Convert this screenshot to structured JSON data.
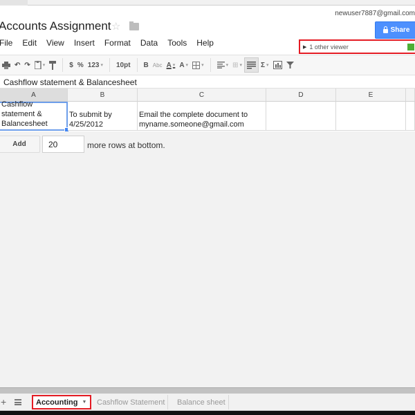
{
  "app": {
    "doc_title": "Accounts Assignment",
    "user_email": "newuser7887@gmail.com",
    "share_label": "Share",
    "viewers_label": "1 other viewer",
    "viewer_color": "#4caf35",
    "accent_color": "#4d90fe",
    "highlight_color": "#e41b23"
  },
  "menu": [
    "File",
    "Edit",
    "View",
    "Insert",
    "Format",
    "Data",
    "Tools",
    "Help"
  ],
  "toolbar": {
    "currency": "$",
    "percent": "%",
    "number_format": "123",
    "font_size": "10pt",
    "bold": "B",
    "strikethrough": "Abc",
    "text_color": "A",
    "fill_color": "A",
    "sum": "Σ"
  },
  "formula_bar": {
    "value": "Cashflow statement & Balancesheet"
  },
  "grid": {
    "columns": [
      "A",
      "B",
      "C",
      "D",
      "E"
    ],
    "selected_column": "A",
    "rows": [
      {
        "cells": [
          "Cashflow statement & Balancesheet",
          "To submit by 4/25/2012",
          "Email the complete document to myname.someone@gmail.com",
          "",
          ""
        ]
      }
    ]
  },
  "add_rows": {
    "button_label": "Add",
    "count": "20",
    "suffix": "more rows at bottom."
  },
  "sheets": {
    "tabs": [
      "Accounting",
      "Cashflow Statement",
      "Balance sheet"
    ],
    "active": "Accounting"
  }
}
